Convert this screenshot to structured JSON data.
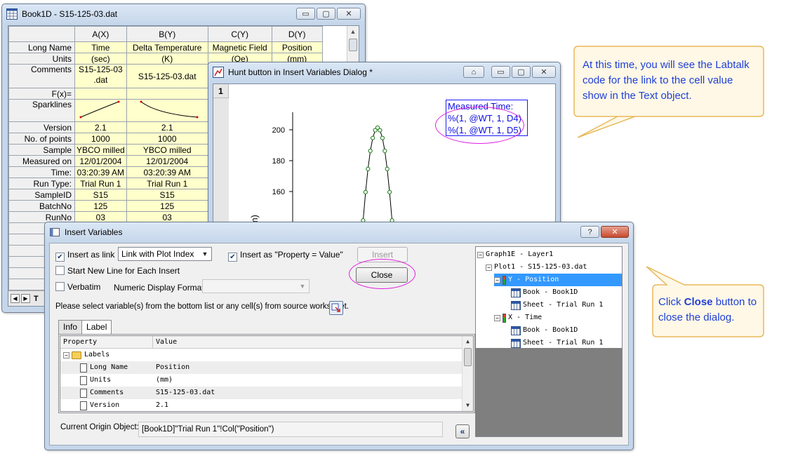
{
  "book": {
    "title": "Book1D - S15-125-03.dat",
    "col_headers": [
      "A(X)",
      "B(Y)",
      "C(Y)",
      "D(Y)"
    ],
    "rows": [
      {
        "label": "Long Name",
        "cells": [
          "Time",
          "Delta Temperature",
          "Magnetic Field",
          "Position"
        ]
      },
      {
        "label": "Units",
        "cells": [
          "(sec)",
          "(K)",
          "(Oe)",
          "(mm)"
        ]
      },
      {
        "label": "Comments",
        "cells": [
          "S15-125-03 .dat",
          "S15-125-03.dat",
          "",
          ""
        ]
      },
      {
        "label": "F(x)=",
        "cells": [
          "",
          "",
          "",
          ""
        ]
      },
      {
        "label": "Sparklines",
        "cells": [
          "",
          "",
          "",
          ""
        ]
      },
      {
        "label": "Version",
        "cells": [
          "2.1",
          "2.1",
          "",
          ""
        ]
      },
      {
        "label": "No. of points",
        "cells": [
          "1000",
          "1000",
          "",
          ""
        ]
      },
      {
        "label": "Sample",
        "cells": [
          "YBCO milled",
          "YBCO milled",
          "",
          ""
        ]
      },
      {
        "label": "Measured on",
        "cells": [
          "12/01/2004",
          "12/01/2004",
          "",
          ""
        ]
      },
      {
        "label": "Time:",
        "cells": [
          "03:20:39 AM",
          "03:20:39 AM",
          "",
          ""
        ]
      },
      {
        "label": "Run Type:",
        "cells": [
          "Trial Run 1",
          "Trial Run 1",
          "",
          ""
        ]
      },
      {
        "label": "SampleID",
        "cells": [
          "S15",
          "S15",
          "",
          ""
        ]
      },
      {
        "label": "BatchNo",
        "cells": [
          "125",
          "125",
          "",
          ""
        ]
      },
      {
        "label": "RunNo",
        "cells": [
          "03",
          "03",
          "",
          ""
        ]
      }
    ],
    "sheet_tab_fragment": "T"
  },
  "graph": {
    "title": "Hunt button in Insert Variables Dialog *",
    "layer_badge": "1",
    "y_ticks": [
      "200",
      "180",
      "160"
    ],
    "y_label_fragment": "ition (mm)",
    "text_object": [
      "Measured Time:",
      "%(1, @WT, 1, D4)",
      "%(1, @WT, 1, D5)"
    ]
  },
  "dialog": {
    "title": "Insert Variables",
    "help_label": "?",
    "insert_as_link": {
      "label": "Insert as link",
      "checked": true
    },
    "link_combo": "Link with Plot Index",
    "insert_as_property": {
      "label": "Insert as \"Property = Value\"",
      "checked": true
    },
    "insert_button": "Insert",
    "close_button": "Close",
    "start_new_line": {
      "label": "Start New Line for Each Insert",
      "checked": false
    },
    "verbatim": {
      "label": "Verbatim",
      "checked": false
    },
    "numeric_format_label": "Numeric Display Format",
    "numeric_format_value": "",
    "instruction": "Please select variable(s) from the bottom list or any cell(s) from source worksheet.",
    "tabs": [
      "Info",
      "Label"
    ],
    "active_tab": "Label",
    "prop_headers": [
      "Property",
      "Value"
    ],
    "props": [
      {
        "k": "Labels",
        "v": ""
      },
      {
        "k": "Long Name",
        "v": "Position"
      },
      {
        "k": "Units",
        "v": "(mm)"
      },
      {
        "k": "Comments",
        "v": "S15-125-03.dat"
      },
      {
        "k": "Version",
        "v": "2.1"
      }
    ],
    "current_object_label": "Current Origin Object:",
    "current_object_value": "[Book1D]\"Trial Run 1\"!Col(\"Position\")",
    "collapse_button": "«",
    "tree": [
      {
        "text": "Graph1E - Layer1"
      },
      {
        "text": "Plot1 - S15-125-03.dat"
      },
      {
        "text": "Y - Position"
      },
      {
        "text": "Book - Book1D"
      },
      {
        "text": "Sheet - Trial Run 1"
      },
      {
        "text": "X - Time"
      },
      {
        "text": "Book - Book1D"
      },
      {
        "text": "Sheet - Trial Run 1"
      }
    ]
  },
  "callouts": {
    "top_right": "At this time, you will see the Labtalk code for the link to the cell value show in the Text object.",
    "bottom_right_pre": "Click ",
    "bottom_right_bold": "Close",
    "bottom_right_post": " button to close the dialog."
  },
  "colors": {
    "label_row_bg": "#ffffcc",
    "text_object_blue": "#1010e0",
    "highlight_magenta": "#e020e0",
    "callout_fill": "#fff8e6",
    "callout_border": "#e8b85a",
    "callout_text": "#1f3fd8",
    "tree_selection": "#3399ff"
  }
}
